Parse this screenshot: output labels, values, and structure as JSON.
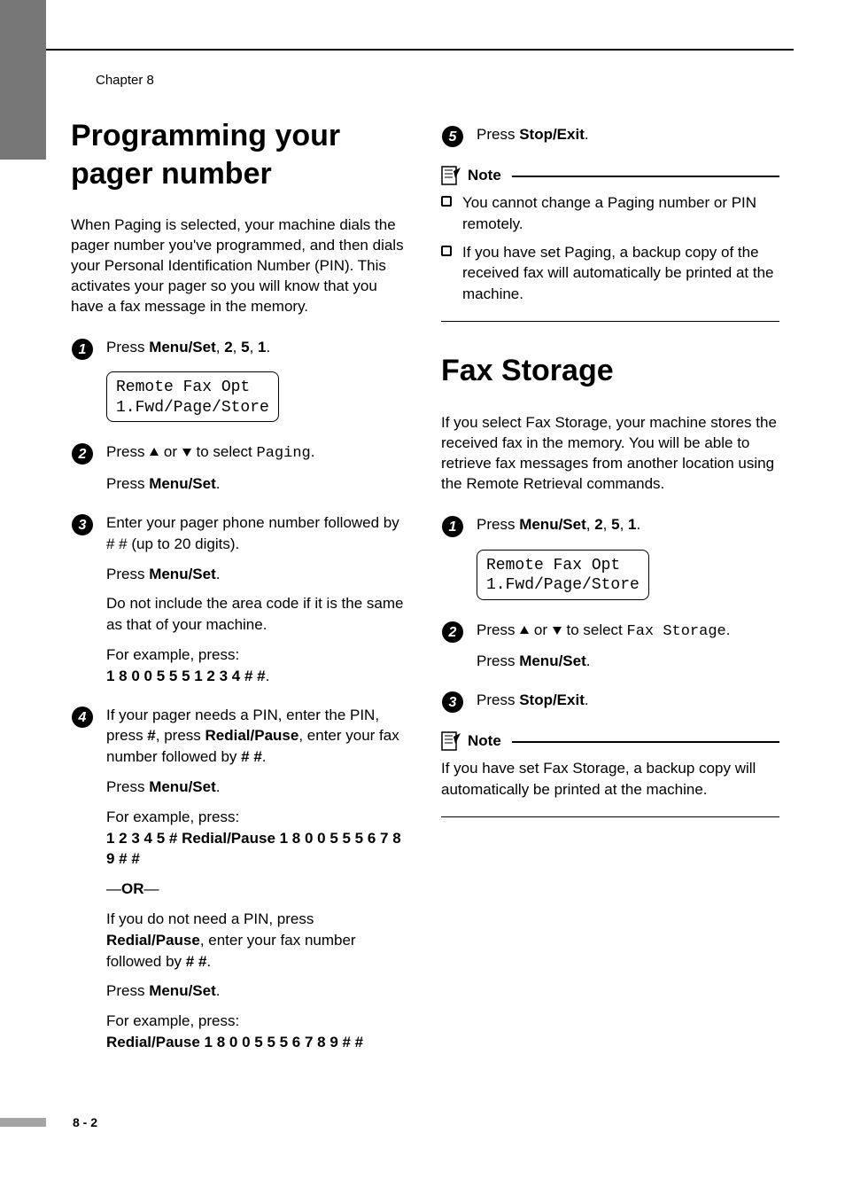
{
  "chapter_label": "Chapter 8",
  "page_number": "8 - 2",
  "notes_label": "Note",
  "left": {
    "heading": "Programming your pager number",
    "intro": "When Paging is selected, your machine dials the pager number you've programmed, and then dials your Personal Identification Number (PIN). This activates your pager so you will know that you have a fax message in the memory.",
    "s1_a": "Press ",
    "s1_b": "Menu/Set",
    "s1_c": ", ",
    "s1_d": "2",
    "s1_e": ", ",
    "s1_f": "5",
    "s1_g": ", ",
    "s1_h": "1",
    "s1_i": ".",
    "lcd1_l1": "Remote Fax Opt",
    "lcd1_l2": "1.Fwd/Page/Store",
    "s2_a": "Press ",
    "s2_b": " or ",
    "s2_c": " to select ",
    "s2_sel": "Paging",
    "s2_d": ".",
    "s2_e": "Press ",
    "s2_f": "Menu/Set",
    "s2_g": ".",
    "s3_a": "Enter your pager phone number followed by # # (up to 20 digits).",
    "s3_b": "Press ",
    "s3_c": "Menu/Set",
    "s3_d": ".",
    "s3_e": "Do not include the area code if it is the same as that of your machine.",
    "s3_f": "For example, press:",
    "s3_g": "1 8 0 0 5 5 5 1 2 3 4 # #",
    "s3_h": ".",
    "s4_a": "If your pager needs a PIN, enter the PIN, press ",
    "s4_b": "#",
    "s4_c": ", press ",
    "s4_d": "Redial/Pause",
    "s4_e": ", enter your fax number followed by ",
    "s4_f": "# #",
    "s4_g": ".",
    "s4_h": "Press ",
    "s4_i": "Menu/Set",
    "s4_j": ".",
    "s4_k": "For example, press:",
    "s4_l": "1 2 3 4 5 # Redial/Pause 1 8 0 0 5 5 5 6 7 8 9 # #",
    "s4_or_a": "—",
    "s4_or_b": "OR",
    "s4_or_c": "—",
    "s4_m": "If you do not need a PIN, press ",
    "s4_n": "Redial/Pause",
    "s4_o": ", enter your fax number followed by ",
    "s4_p": "# #",
    "s4_q": ".",
    "s4_r": "Press ",
    "s4_s": "Menu/Set",
    "s4_t": ".",
    "s4_u": "For example, press:",
    "s4_v": "Redial/Pause 1 8 0 0 5 5 5 6 7 8 9 # #"
  },
  "right": {
    "s5_a": "Press ",
    "s5_b": "Stop/Exit",
    "s5_c": ".",
    "note1_li1": "You cannot change a Paging number or PIN remotely.",
    "note1_li2": "If you have set Paging, a backup copy of the received fax will automatically be printed at the machine.",
    "heading": "Fax Storage",
    "intro": "If you select Fax Storage, your machine stores the received fax in the memory. You will be able to retrieve fax messages from another location using the Remote Retrieval commands.",
    "s1_a": "Press ",
    "s1_b": "Menu/Set",
    "s1_c": ", ",
    "s1_d": "2",
    "s1_e": ", ",
    "s1_f": "5",
    "s1_g": ", ",
    "s1_h": "1",
    "s1_i": ".",
    "lcd2_l1": "Remote Fax Opt",
    "lcd2_l2": "1.Fwd/Page/Store",
    "s2_a": "Press ",
    "s2_b": " or ",
    "s2_c": " to select ",
    "s2_sel": "Fax Storage",
    "s2_d": ".",
    "s2_e": "Press ",
    "s2_f": "Menu/Set",
    "s2_g": ".",
    "s3_a": "Press ",
    "s3_b": "Stop/Exit",
    "s3_c": ".",
    "note2": "If you have set Fax Storage, a backup copy will automatically be printed at the machine."
  }
}
